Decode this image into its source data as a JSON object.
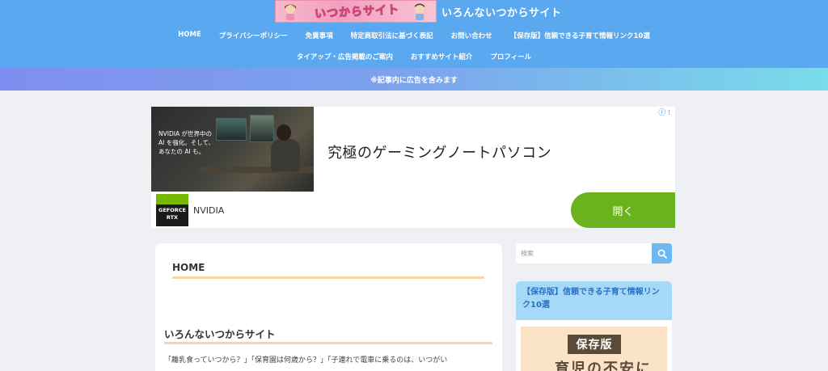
{
  "header": {
    "logo_text": "いつからサイト",
    "site_title": "いろんないつからサイト",
    "nav_row1": [
      {
        "label": "HOME"
      },
      {
        "label": "プライバシーポリシー"
      },
      {
        "label": "免責事項"
      },
      {
        "label": "特定商取引法に基づく表記"
      },
      {
        "label": "お問い合わせ"
      },
      {
        "label": "【保存版】信頼できる子育て情報リンク10選"
      }
    ],
    "nav_row2": [
      {
        "label": "タイアップ・広告掲載のご案内"
      },
      {
        "label": "おすすめサイト紹介"
      },
      {
        "label": "プロフィール"
      }
    ],
    "notice": "※記事内に広告を含みます"
  },
  "ad": {
    "photo_text": "NVIDIA が世界中の AI を強化。そして、あなたの AI も。",
    "headline": "究極のゲーミングノートパソコン",
    "badge": "ⓘ ⁝",
    "brand_logo_line1": "GEFORCE",
    "brand_logo_line2": "RTX",
    "brand_name": "NVIDIA",
    "cta": "開く"
  },
  "main": {
    "home_title": "HOME",
    "section_title": "いろんないつからサイト",
    "body_text": "「離乳食っていつから？」「保育園は何歳から？」「子連れで電車に乗るのは、いつがい"
  },
  "sidebar": {
    "search_placeholder": "検索",
    "widget_title": "【保存版】信頼できる子育て情報リンク10選",
    "widget_image_tag": "保存版",
    "widget_image_caption": "育児の不安に"
  },
  "colors": {
    "header_bg": "#5aa8f0",
    "accent_line": "#f8d5a4",
    "ad_cta": "#6ab31e",
    "widget_header_bg": "#a6d8f8",
    "widget_title_text": "#2c72c4"
  }
}
